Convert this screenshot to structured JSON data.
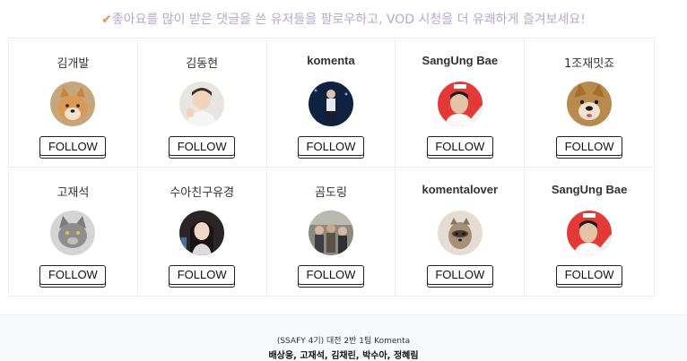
{
  "banner": {
    "check_glyph": "✔",
    "text": "좋아요를 많이 받은 댓글을 쓴 유저들을 팔로우하고, VOD 시청을 더 유쾌하게 즐겨보세요!"
  },
  "users": [
    {
      "name": "김개발",
      "avatar": "shiba-dog",
      "button": "FOLLOW"
    },
    {
      "name": "김동현",
      "avatar": "person-photo",
      "button": "FOLLOW"
    },
    {
      "name": "komenta",
      "avatar": "stage-performer",
      "button": "FOLLOW"
    },
    {
      "name": "SangUng Bae",
      "avatar": "soccer-player",
      "button": "FOLLOW"
    },
    {
      "name": "1조재밋죠",
      "avatar": "shiba-dog-closeup",
      "button": "FOLLOW"
    },
    {
      "name": "고재석",
      "avatar": "gray-cat",
      "button": "FOLLOW"
    },
    {
      "name": "수아친구유경",
      "avatar": "person-photo",
      "button": "FOLLOW"
    },
    {
      "name": "곰도링",
      "avatar": "group-photo",
      "button": "FOLLOW"
    },
    {
      "name": "komentalover",
      "avatar": "raccoon",
      "button": "FOLLOW"
    },
    {
      "name": "SangUng Bae",
      "avatar": "soccer-player",
      "button": "FOLLOW"
    }
  ],
  "footer": {
    "line1": "(SSAFY 4기) 대전 2반 1팀 Komenta",
    "line2": "배상웅, 고재석, 김채린, 박수아, 정혜림"
  },
  "colors": {
    "banner_text": "#b7a7cf",
    "check": "#f28a4a",
    "footer_bg": "#f6f9fc"
  }
}
